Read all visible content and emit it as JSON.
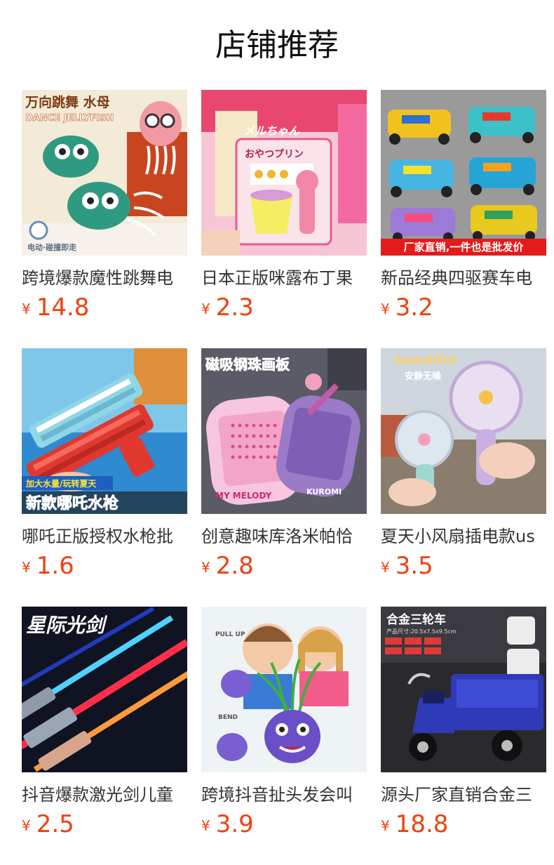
{
  "header": {
    "title": "店铺推荐"
  },
  "products": [
    {
      "name": "跨境爆款魔性跳舞电",
      "currency": "¥",
      "price": "14.8",
      "image_texts": [
        "万向跳舞 水母",
        "DANCE JELLYFISH",
        "电动·碰撞即走"
      ],
      "icon": "dancing-jellyfish-toy"
    },
    {
      "name": "日本正版咪露布丁果",
      "currency": "¥",
      "price": "2.3",
      "image_texts": [
        "メルちゃん",
        "おやつプリン"
      ],
      "icon": "pudding-toy-set"
    },
    {
      "name": "新品经典四驱赛车电",
      "currency": "¥",
      "price": "3.2",
      "image_texts": [
        "厂家直销,一件也是批发价"
      ],
      "icon": "race-car-toys"
    },
    {
      "name": "哪吒正版授权水枪批",
      "currency": "¥",
      "price": "1.6",
      "image_texts": [
        "加大水量/玩转夏天",
        "新款哪吒水枪"
      ],
      "icon": "water-gun-toy"
    },
    {
      "name": "创意趣味库洛米帕恰",
      "currency": "¥",
      "price": "2.8",
      "image_texts": [
        "磁吸钢珠画板",
        "MY MELODY",
        "KUROMI"
      ],
      "icon": "magnetic-drawing-board"
    },
    {
      "name": "夏天小风扇插电款us",
      "currency": "¥",
      "price": "3.5",
      "image_texts": [
        "beautiful",
        "安静无噪"
      ],
      "icon": "handheld-fan"
    },
    {
      "name": "抖音爆款激光剑儿童",
      "currency": "¥",
      "price": "2.5",
      "image_texts": [
        "星际光剑"
      ],
      "icon": "light-saber-toy"
    },
    {
      "name": "跨境抖音扯头发会叫",
      "currency": "¥",
      "price": "3.9",
      "image_texts": [
        "PULL UP",
        "BEND"
      ],
      "icon": "hair-pull-monster-toy"
    },
    {
      "name": "源头厂家直销合金三",
      "currency": "¥",
      "price": "18.8",
      "image_texts": [
        "合金三轮车",
        "产品尺寸:20.5x7.5x9.5cm"
      ],
      "icon": "alloy-tricycle-toy"
    }
  ]
}
